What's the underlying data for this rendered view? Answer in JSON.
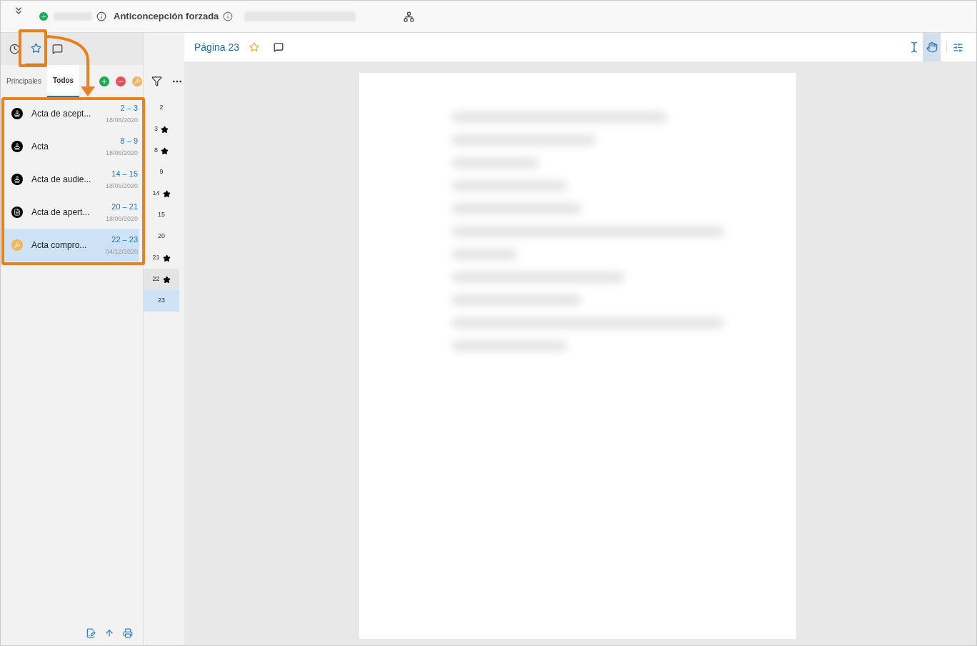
{
  "header": {
    "title": "Anticoncepción forzada"
  },
  "sidebar_tabs": [
    {
      "kind": "history",
      "selected": false
    },
    {
      "kind": "star",
      "selected": true
    },
    {
      "kind": "comments",
      "selected": false
    }
  ],
  "sub_tabs": [
    {
      "label": "Principales",
      "selected": false
    },
    {
      "label": "Todos",
      "selected": true
    }
  ],
  "bookmarks": [
    {
      "title": "Acta de acept...",
      "pages": "2 – 3",
      "date": "18/06/2020",
      "kind": "stamp",
      "selected": false
    },
    {
      "title": "Acta",
      "pages": "8 – 9",
      "date": "18/06/2020",
      "kind": "stamp",
      "selected": false
    },
    {
      "title": "Acta de audie...",
      "pages": "14 – 15",
      "date": "18/06/2020",
      "kind": "stamp",
      "selected": false
    },
    {
      "title": "Acta de apert...",
      "pages": "20 – 21",
      "date": "18/06/2020",
      "kind": "document",
      "selected": false
    },
    {
      "title": "Acta compro...",
      "pages": "22 – 23",
      "date": "04/12/2020",
      "kind": "gavel",
      "selected": true
    }
  ],
  "page_list": [
    {
      "page": "2",
      "starred": false,
      "selected": false,
      "hovered": false
    },
    {
      "page": "3",
      "starred": true,
      "selected": false,
      "hovered": false
    },
    {
      "page": "8",
      "starred": true,
      "selected": false,
      "hovered": false
    },
    {
      "page": "9",
      "starred": false,
      "selected": false,
      "hovered": false
    },
    {
      "page": "14",
      "starred": true,
      "selected": false,
      "hovered": false
    },
    {
      "page": "15",
      "starred": false,
      "selected": false,
      "hovered": false
    },
    {
      "page": "20",
      "starred": false,
      "selected": false,
      "hovered": false
    },
    {
      "page": "21",
      "starred": true,
      "selected": false,
      "hovered": false
    },
    {
      "page": "22",
      "starred": true,
      "selected": false,
      "hovered": true
    },
    {
      "page": "23",
      "starred": false,
      "selected": true,
      "hovered": false
    }
  ],
  "viewer": {
    "page_label": "Página 23",
    "tools": [
      {
        "kind": "text-select",
        "selected": false
      },
      {
        "kind": "hand",
        "selected": true
      }
    ]
  }
}
